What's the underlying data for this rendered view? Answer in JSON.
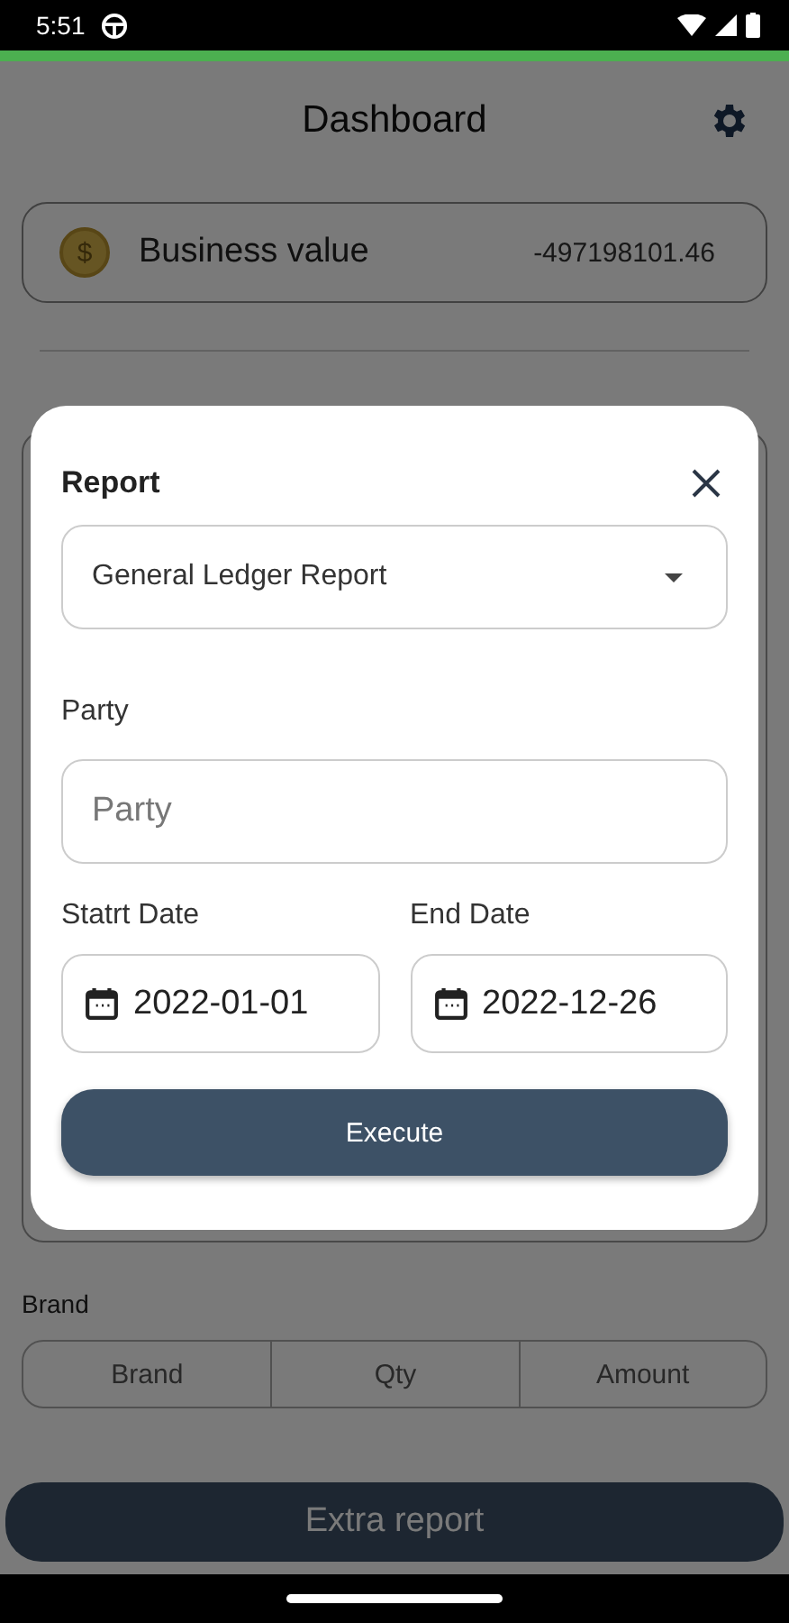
{
  "status_bar": {
    "time": "5:51"
  },
  "header": {
    "title": "Dashboard"
  },
  "business_value": {
    "label": "Business value",
    "value": "-497198101.46",
    "currency_symbol": "$"
  },
  "brand_section": {
    "label": "Brand",
    "columns": [
      "Brand",
      "Qty",
      "Amount"
    ]
  },
  "extra_report_button": "Extra report",
  "dialog": {
    "title": "Report",
    "report_select": {
      "value": "General Ledger Report"
    },
    "party": {
      "label": "Party",
      "placeholder": "Party"
    },
    "start_date": {
      "label": "Statrt Date",
      "value": "2022-01-01"
    },
    "end_date": {
      "label": "End Date",
      "value": "2022-12-26"
    },
    "execute_button": "Execute"
  }
}
